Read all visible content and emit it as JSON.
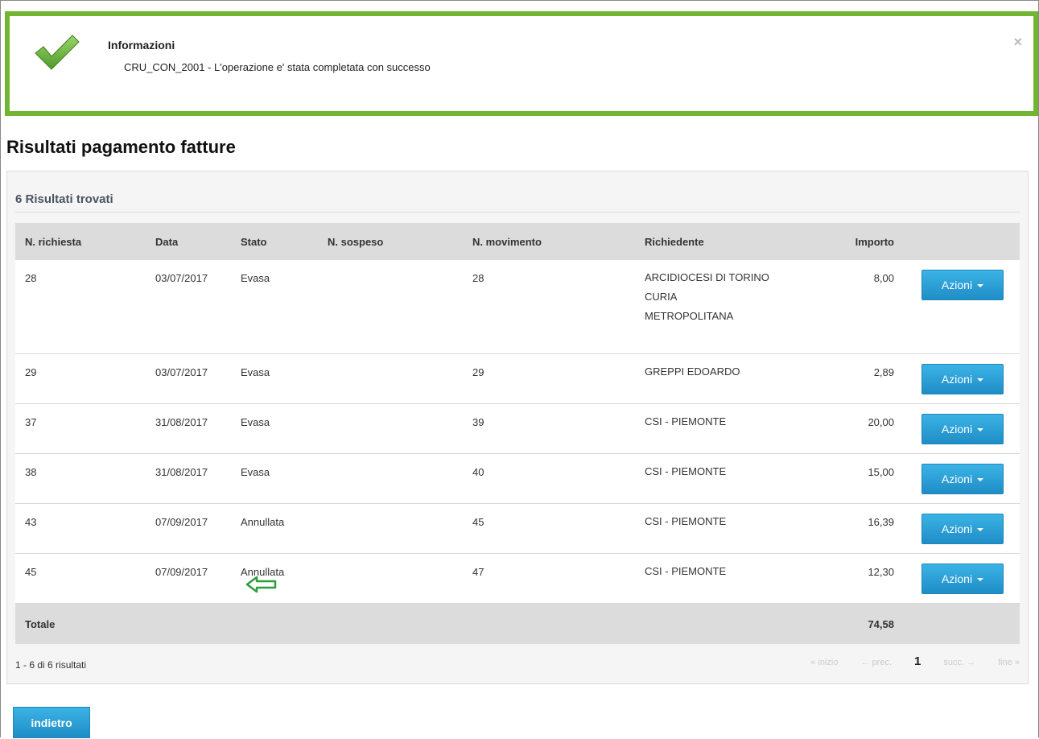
{
  "alert": {
    "title": "Informazioni",
    "message": "CRU_CON_2001 - L'operazione e' stata completata con successo",
    "close": "×",
    "border_color": "#72b533"
  },
  "page": {
    "title": "Risultati pagamento fatture"
  },
  "results": {
    "count_label": "6 Risultati trovati",
    "columns": [
      "N. richiesta",
      "Data",
      "Stato",
      "N. sospeso",
      "N. movimento",
      "Richiedente",
      "Importo"
    ],
    "rows": [
      {
        "n_richiesta": "28",
        "data": "03/07/2017",
        "stato": "Evasa",
        "n_sospeso": "",
        "n_movimento": "28",
        "richiedente": [
          "ARCIDIOCESI DI TORINO",
          "CURIA",
          "METROPOLITANA"
        ],
        "importo": "8,00"
      },
      {
        "n_richiesta": "29",
        "data": "03/07/2017",
        "stato": "Evasa",
        "n_sospeso": "",
        "n_movimento": "29",
        "richiedente": [
          "GREPPI EDOARDO"
        ],
        "importo": "2,89"
      },
      {
        "n_richiesta": "37",
        "data": "31/08/2017",
        "stato": "Evasa",
        "n_sospeso": "",
        "n_movimento": "39",
        "richiedente": [
          "CSI - PIEMONTE"
        ],
        "importo": "20,00"
      },
      {
        "n_richiesta": "38",
        "data": "31/08/2017",
        "stato": "Evasa",
        "n_sospeso": "",
        "n_movimento": "40",
        "richiedente": [
          "CSI - PIEMONTE"
        ],
        "importo": "15,00"
      },
      {
        "n_richiesta": "43",
        "data": "07/09/2017",
        "stato": "Annullata",
        "n_sospeso": "",
        "n_movimento": "45",
        "richiedente": [
          "CSI - PIEMONTE"
        ],
        "importo": "16,39"
      },
      {
        "n_richiesta": "45",
        "data": "07/09/2017",
        "stato": "Annullata",
        "n_sospeso": "",
        "n_movimento": "47",
        "richiedente": [
          "CSI - PIEMONTE"
        ],
        "importo": "12,30",
        "annotated": true
      }
    ],
    "action_label": "Azioni",
    "total_label": "Totale",
    "total_value": "74,58",
    "pager_info": "1 - 6 di 6 risultati",
    "pager": {
      "first": "« inizio",
      "prev": "← prec.",
      "current": "1",
      "next": "succ. →",
      "last": "fine »"
    }
  },
  "back_button": "indietro",
  "colors": {
    "accent": "#2aa0d8",
    "success": "#72b533",
    "annotation_arrow": "#2e9e3e"
  }
}
